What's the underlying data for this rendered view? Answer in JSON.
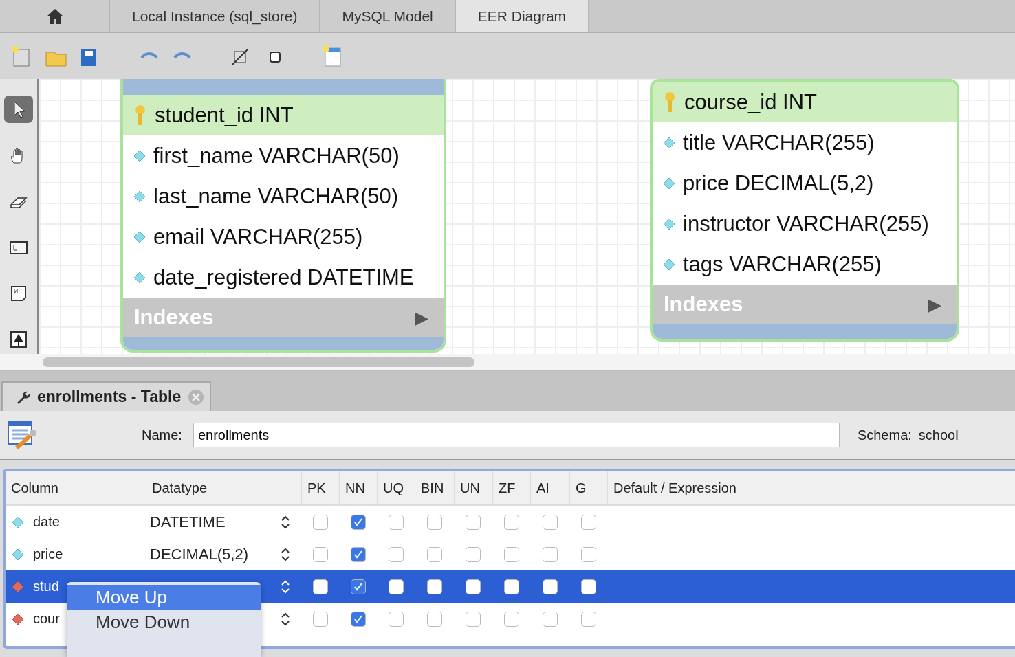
{
  "tabs": [
    {
      "kind": "home",
      "selected": false
    },
    {
      "kind": "text",
      "label": "Local Instance  (sql_store)",
      "selected": false
    },
    {
      "kind": "text",
      "label": "MySQL Model",
      "selected": false
    },
    {
      "kind": "text",
      "label": "EER Diagram",
      "selected": true
    }
  ],
  "palette": [
    {
      "kind": "pointer",
      "selected": true
    },
    {
      "kind": "hand",
      "selected": false
    },
    {
      "kind": "eraser",
      "selected": false
    },
    {
      "kind": "layer",
      "selected": false
    },
    {
      "kind": "note",
      "selected": false
    },
    {
      "kind": "image",
      "selected": false
    }
  ],
  "diagram_tables": [
    {
      "top_band": true,
      "columns": [
        {
          "kind": "primary",
          "text": "student_id INT"
        },
        {
          "kind": "regular",
          "text": "first_name VARCHAR(50)"
        },
        {
          "kind": "regular",
          "text": "last_name VARCHAR(50)"
        },
        {
          "kind": "regular",
          "text": "email VARCHAR(255)"
        },
        {
          "kind": "regular",
          "text": "date_registered DATETIME"
        }
      ],
      "indexes_label": "Indexes",
      "indexes_arrow": "▶"
    },
    {
      "top_band": false,
      "columns": [
        {
          "kind": "primary",
          "text": "course_id INT"
        },
        {
          "kind": "regular",
          "text": "title VARCHAR(255)"
        },
        {
          "kind": "regular",
          "text": "price DECIMAL(5,2)"
        },
        {
          "kind": "regular",
          "text": "instructor VARCHAR(255)"
        },
        {
          "kind": "regular",
          "text": "tags VARCHAR(255)"
        }
      ],
      "indexes_label": "Indexes",
      "indexes_arrow": "▶"
    }
  ],
  "editor_tab": {
    "title": "enrollments - Table"
  },
  "name_label": "Name:",
  "name_value": "enrollments",
  "schema_label": "Schema:",
  "schema_value": "school",
  "grid": {
    "columns": [
      "Column",
      "Datatype",
      "PK",
      "NN",
      "UQ",
      "BIN",
      "UN",
      "ZF",
      "AI",
      "G",
      "Default / Expression"
    ],
    "rows": [
      {
        "kind": "regular",
        "name": "date",
        "datatype": "DATETIME",
        "selected": false,
        "flags": [
          false,
          true,
          false,
          false,
          false,
          false,
          false,
          false
        ]
      },
      {
        "kind": "regular",
        "name": "price",
        "datatype": "DECIMAL(5,2)",
        "selected": false,
        "flags": [
          false,
          true,
          false,
          false,
          false,
          false,
          false,
          false
        ]
      },
      {
        "kind": "foreign",
        "name": "stud",
        "selected": true,
        "flags": [
          false,
          true,
          false,
          false,
          false,
          false,
          false,
          false
        ]
      },
      {
        "kind": "foreign",
        "name": "cour",
        "selected": false,
        "flags": [
          false,
          true,
          false,
          false,
          false,
          false,
          false,
          false
        ]
      }
    ]
  },
  "context_menu": [
    {
      "label": "Move Up",
      "selected": true
    },
    {
      "label": "Move Down",
      "selected": false
    }
  ]
}
